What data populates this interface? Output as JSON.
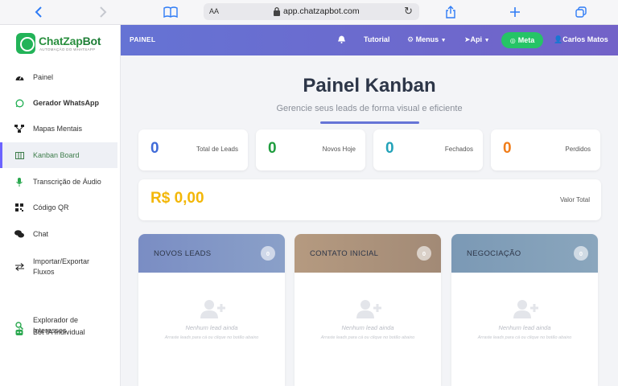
{
  "browser": {
    "text_size_label": "AA",
    "url": "app.chatzapbot.com"
  },
  "brand": {
    "name_part1": "ChatZap",
    "name_part2": "Bot",
    "tagline": "AUTOMAÇÃO DO WHATSAPP"
  },
  "sidebar": {
    "items": [
      {
        "label": "Painel",
        "icon": "dashboard-icon"
      },
      {
        "label": "Gerador WhatsApp",
        "icon": "whatsapp-icon"
      },
      {
        "label": "Mapas Mentais",
        "icon": "sitemap-icon"
      },
      {
        "label": "Kanban Board",
        "icon": "kanban-icon"
      },
      {
        "label": "Transcrição de Áudio",
        "icon": "microphone-icon"
      },
      {
        "label": "Código QR",
        "icon": "qrcode-icon"
      },
      {
        "label": "Chat",
        "icon": "chat-icon"
      },
      {
        "label": "Importar/Exportar Fluxos",
        "icon": "exchange-icon"
      },
      {
        "label": "Explorador de Interesses",
        "icon": "search-icon"
      },
      {
        "label": "Bot IA Individual",
        "icon": "robot-icon"
      }
    ]
  },
  "header": {
    "title": "PAINEL",
    "tutorial": "Tutorial",
    "menus": "Menus",
    "api": "Api",
    "meta": "Meta",
    "user": "Carlos Matos"
  },
  "page": {
    "title": "Painel Kanban",
    "subtitle": "Gerencie seus leads de forma visual e eficiente"
  },
  "stats": [
    {
      "value": "0",
      "label": "Total de Leads",
      "color": "#3f6ad8"
    },
    {
      "value": "0",
      "label": "Novos Hoje",
      "color": "#1f9d3f"
    },
    {
      "value": "0",
      "label": "Fechados",
      "color": "#22a2b8"
    },
    {
      "value": "0",
      "label": "Perdidos",
      "color": "#f07d1a"
    }
  ],
  "total": {
    "amount": "R$ 0,00",
    "label": "Valor Total"
  },
  "columns": [
    {
      "title": "NOVOS LEADS",
      "count": "0",
      "color": "#7f91c2",
      "empty_title": "Nenhum lead ainda",
      "empty_hint": "Arraste leads para cá ou clique no botão abaixo"
    },
    {
      "title": "CONTATO INICIAL",
      "count": "0",
      "color": "#a99078",
      "empty_title": "Nenhum lead ainda",
      "empty_hint": "Arraste leads para cá ou clique no botão abaixo"
    },
    {
      "title": "NEGOCIAÇÃO",
      "count": "0",
      "color": "#7d9bb5",
      "empty_title": "Nenhum lead ainda",
      "empty_hint": "Arraste leads para cá ou clique no botão abaixo"
    }
  ]
}
